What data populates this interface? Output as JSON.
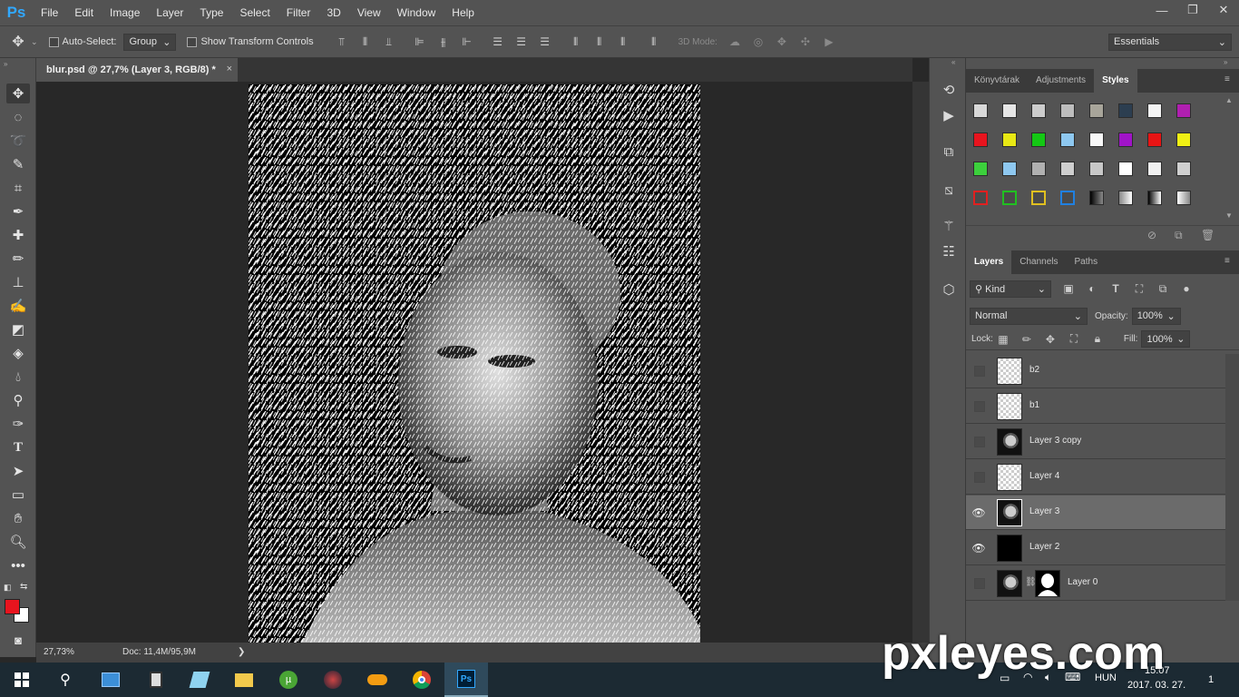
{
  "app": {
    "logo": "Ps"
  },
  "menu": [
    "File",
    "Edit",
    "Image",
    "Layer",
    "Type",
    "Select",
    "Filter",
    "3D",
    "View",
    "Window",
    "Help"
  ],
  "window_controls": {
    "minimize": "—",
    "restore": "❐",
    "close": "✕"
  },
  "options_bar": {
    "auto_select_label": "Auto-Select:",
    "auto_select_value": "Group",
    "show_transform_label": "Show Transform Controls",
    "mode_3d_label": "3D Mode:",
    "workspace": "Essentials"
  },
  "document_tab": {
    "title": "blur.psd @ 27,7% (Layer 3, RGB/8) *",
    "close": "×"
  },
  "status_bar": {
    "zoom": "27,73%",
    "doc": "Doc: 11,4M/95,9M",
    "arrow": "❯"
  },
  "styles_panel": {
    "tabs": [
      "Könyvtárak",
      "Adjustments",
      "Styles"
    ],
    "active_tab": "Styles"
  },
  "layers_panel": {
    "tabs": [
      "Layers",
      "Channels",
      "Paths"
    ],
    "active_tab": "Layers",
    "filter_kind": "Kind",
    "blend_mode": "Normal",
    "opacity_label": "Opacity:",
    "opacity_value": "100%",
    "lock_label": "Lock:",
    "fill_label": "Fill:",
    "fill_value": "100%",
    "layers": [
      {
        "name": "b2",
        "visible": false,
        "thumb": "checker",
        "selected": false
      },
      {
        "name": "b1",
        "visible": false,
        "thumb": "checker",
        "selected": false
      },
      {
        "name": "Layer 3 copy",
        "visible": false,
        "thumb": "portrait",
        "selected": false
      },
      {
        "name": "Layer 4",
        "visible": false,
        "thumb": "checker",
        "selected": false
      },
      {
        "name": "Layer 3",
        "visible": true,
        "thumb": "portrait",
        "selected": true
      },
      {
        "name": "Layer 2",
        "visible": true,
        "thumb": "black",
        "selected": false
      },
      {
        "name": "Layer 0",
        "visible": false,
        "thumb": "portrait",
        "selected": false,
        "has_mask": true
      }
    ]
  },
  "colors": {
    "foreground": "#e8141e",
    "background": "#ffffff",
    "accent": "#31a8ff"
  },
  "taskbar": {
    "language": "HUN",
    "time": "15:07",
    "date": "2017. 03. 27.",
    "notification_count": "1",
    "apps": [
      "file-explorer-icon",
      "calculator-icon",
      "app-icon",
      "folder-icon",
      "utorrent-icon",
      "app-icon",
      "app-icon",
      "chrome-icon",
      "photoshop-icon"
    ]
  },
  "watermark": "pxleyes.com"
}
